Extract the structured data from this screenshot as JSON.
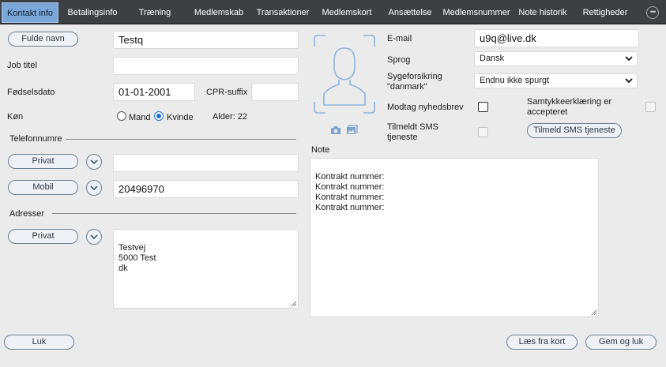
{
  "tabs": [
    {
      "label": "Kontakt info",
      "active": true
    },
    {
      "label": "Betalingsinfo"
    },
    {
      "label": "Træning"
    },
    {
      "label": "Medlemskab"
    },
    {
      "label": "Transaktioner"
    },
    {
      "label": "Medlemskort"
    },
    {
      "label": "Ansættelse"
    },
    {
      "label": "Medlemsnummer"
    },
    {
      "label": "Note historik"
    },
    {
      "label": "Rettigheder"
    }
  ],
  "tab_more_icon": "ellipsis-circle-icon",
  "left": {
    "name_button": "Fulde navn",
    "name_value": "Testq",
    "job_title_label": "Job titel",
    "job_title_value": "",
    "birthdate_label": "Fødselsdato",
    "birthdate_value": "01-01-2001",
    "cpr_label": "CPR-suffix",
    "cpr_value": "",
    "gender_label": "Køn",
    "gender_options": [
      "Mand",
      "Kvinde"
    ],
    "gender_selected": "Kvinde",
    "age_text": "Alder: 22",
    "phones_heading": "Telefonnumre",
    "phones": [
      {
        "type": "Privat",
        "value": ""
      },
      {
        "type": "Mobil",
        "value": "20496970"
      }
    ],
    "address_heading": "Adresser",
    "address_type": "Privat",
    "address_value": "Testvej\n5000 Test\ndk"
  },
  "photo": {
    "placeholder_icon": "user-silhouette-icon",
    "camera_icon": "camera-icon",
    "gallery_icon": "image-gallery-icon"
  },
  "right": {
    "email_label": "E-mail",
    "email_value": "u9q@live.dk",
    "language_label": "Sprog",
    "language_value": "Dansk",
    "insurance_label": "Sygeforsikring \"danmark\"",
    "insurance_value": "Endnu ikke spurgt",
    "newsletter_label": "Modtag nyhedsbrev",
    "newsletter_checked": false,
    "consent_label": "Samtykkeerklæring er accepteret",
    "consent_checked": false,
    "sms_label": "Tilmeldt SMS tjeneste",
    "sms_checked": false,
    "sms_button": "Tilmeld SMS tjeneste",
    "note_label": "Note",
    "note_value": "Kontrakt nummer:\nKontrakt nummer:\nKontrakt nummer:\nKontrakt nummer:"
  },
  "footer": {
    "close_button": "Luk",
    "read_card_button": "Læs fra kort",
    "save_close_button": "Gem og luk"
  },
  "colors": {
    "tabbar_bg": "#3d4043",
    "tab_active_bg": "#7aa6d8",
    "panel_bg": "#ebebeb",
    "pill_border": "#6b7e93",
    "photo_outline": "#8fb4dc",
    "radio_accent": "#1f6fd1"
  }
}
